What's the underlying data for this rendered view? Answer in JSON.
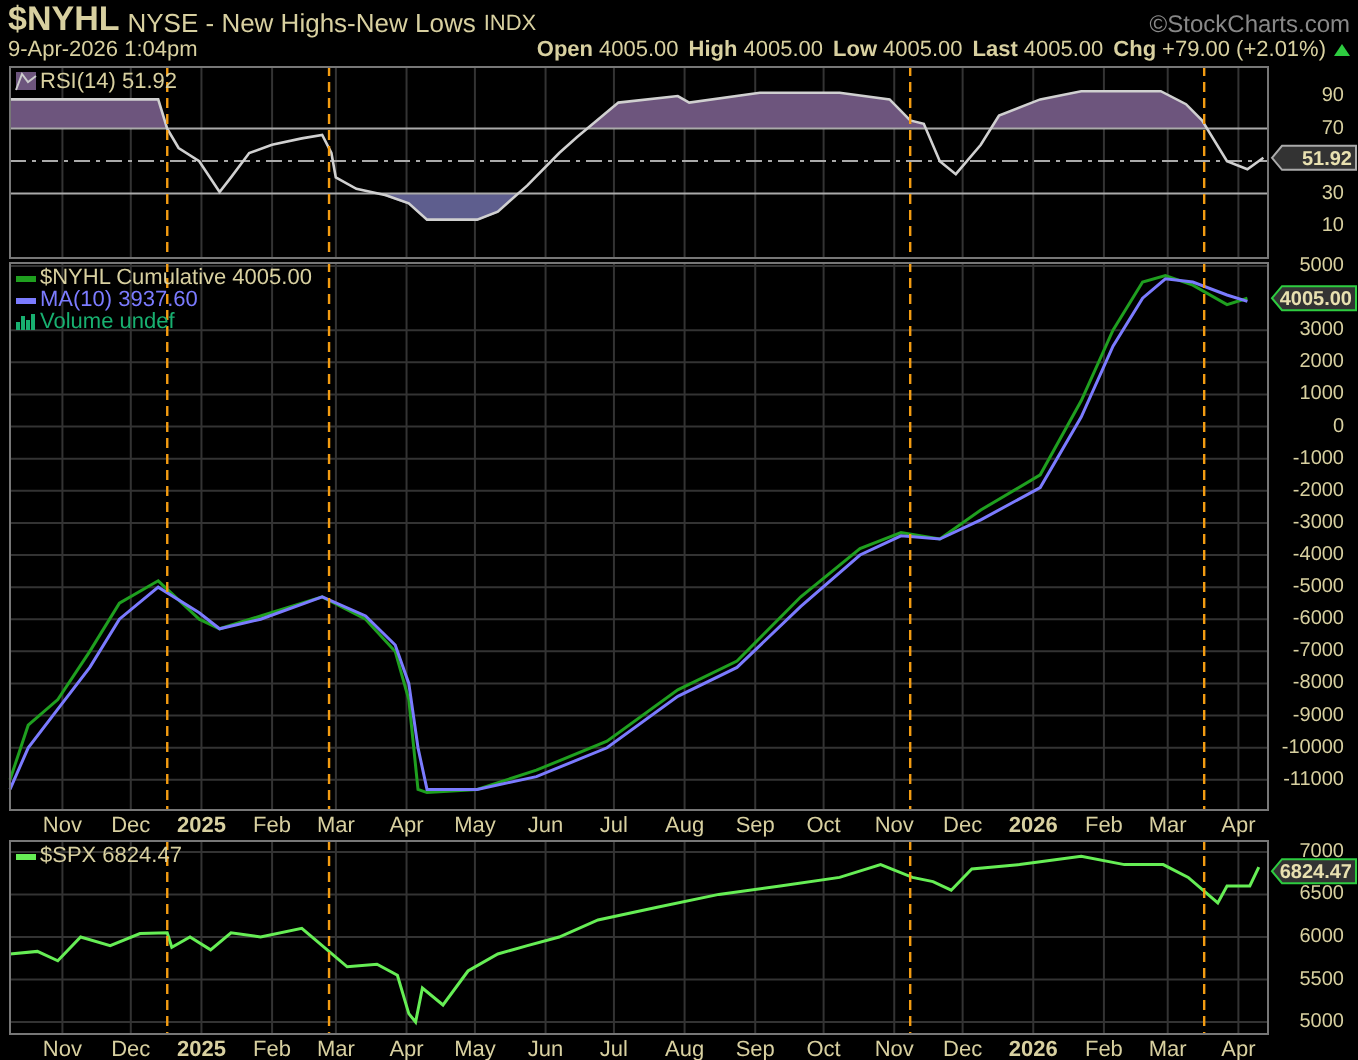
{
  "header": {
    "symbol": "$NYHL",
    "name": "NYSE - New Highs-New Lows",
    "exchange": "INDX",
    "brand": "©StockCharts.com",
    "date": "9-Apr-2026 1:04pm",
    "quotes": [
      {
        "label": "Open",
        "value": "4005.00"
      },
      {
        "label": "High",
        "value": "4005.00"
      },
      {
        "label": "Low",
        "value": "4005.00"
      },
      {
        "label": "Last",
        "value": "4005.00"
      },
      {
        "label": "Chg",
        "value": "+79.00 (+2.01%)"
      }
    ]
  },
  "panels": [
    {
      "kind": "rsi",
      "legend": [
        {
          "kind": "area",
          "value": "51.92",
          "color": "#d8d0a0"
        }
      ],
      "tag": "51.92",
      "chart_data": {
        "type": "line",
        "grid": true,
        "xlim": [
          "2024-10-09",
          "2026-04-14"
        ],
        "ylim": [
          -9.6,
          108.5
        ],
        "x": [
          "2024-10-09",
          "2024-12-13",
          "2024-12-17",
          "2024-12-22",
          "2024-12-31",
          "2025-01-09",
          "2025-01-14",
          "2025-01-22",
          "2025-02-01",
          "2025-02-14",
          "2025-02-23",
          "2025-02-27",
          "2025-03-01",
          "2025-03-10",
          "2025-03-23",
          "2025-04-02",
          "2025-04-10",
          "2025-05-02",
          "2025-05-11",
          "2025-05-24",
          "2025-06-07",
          "2025-06-15",
          "2025-07-03",
          "2025-07-29",
          "2025-08-03",
          "2025-09-03",
          "2025-10-08",
          "2025-10-30",
          "2025-11-08",
          "2025-11-14",
          "2025-11-21",
          "2025-11-28",
          "2025-12-09",
          "2025-12-17",
          "2026-01-04",
          "2026-01-22",
          "2026-02-26",
          "2026-03-09",
          "2026-03-16",
          "2026-03-27",
          "2026-04-05",
          "2026-04-12"
        ],
        "series": [
          {
            "name": "RSI(14)",
            "color": "#d0d0d0",
            "values": [
              88,
              88,
              70,
              58,
              50,
              31,
              40,
              55,
              60,
              64,
              66,
              55,
              40,
              33,
              29,
              24,
              14,
              14,
              19,
              35,
              55,
              65,
              86,
              90,
              86,
              92,
              92,
              88,
              75,
              73,
              50,
              42,
              60,
              78,
              88,
              93,
              93,
              85,
              75,
              50,
              45,
              52
            ]
          }
        ],
        "yticks": [
          10,
          30,
          70,
          90
        ],
        "ref_lines": [
          {
            "axis": "y",
            "value": 70
          },
          {
            "axis": "y",
            "value": 50
          },
          {
            "axis": "y",
            "value": 30
          },
          {
            "axis": "x",
            "value": "2024-12-17"
          },
          {
            "axis": "x",
            "value": "2025-02-26"
          },
          {
            "axis": "x",
            "value": "2025-11-08"
          },
          {
            "axis": "x",
            "value": "2026-03-17"
          }
        ]
      }
    },
    {
      "kind": "price",
      "legend": [
        {
          "kind": "line",
          "value": "4005.00",
          "color": "#d8d0a0"
        },
        {
          "kind": "line",
          "value": "3937.60",
          "color": "#7b7bff"
        },
        {
          "kind": "volume",
          "text": "Volume undef",
          "color": "#18b070"
        }
      ],
      "tag": "4005.00",
      "chart_data": {
        "type": "line",
        "grid": true,
        "xlim": [
          "2024-10-09",
          "2026-04-14"
        ],
        "ylim": [
          -11940,
          5125
        ],
        "x": [
          "2024-10-09",
          "2024-10-17",
          "2024-10-30",
          "2024-11-13",
          "2024-11-26",
          "2024-12-13",
          "2024-12-31",
          "2025-01-09",
          "2025-01-27",
          "2025-02-23",
          "2025-03-14",
          "2025-03-27",
          "2025-04-02",
          "2025-04-06",
          "2025-04-10",
          "2025-05-02",
          "2025-05-28",
          "2025-06-28",
          "2025-07-29",
          "2025-08-24",
          "2025-09-21",
          "2025-10-17",
          "2025-11-04",
          "2025-11-21",
          "2025-12-09",
          "2026-01-04",
          "2026-01-22",
          "2026-02-05",
          "2026-02-18",
          "2026-02-28",
          "2026-03-12",
          "2026-03-27",
          "2026-04-05"
        ],
        "series": [
          {
            "name": "$NYHL Cumulative",
            "color": "#1f9f1f",
            "values": [
              -11000,
              -9300,
              -8500,
              -7000,
              -5500,
              -4800,
              -6000,
              -6300,
              -5900,
              -5300,
              -6000,
              -7000,
              -8500,
              -11300,
              -11400,
              -11300,
              -10700,
              -9800,
              -8200,
              -7300,
              -5300,
              -3800,
              -3300,
              -3500,
              -2600,
              -1500,
              800,
              3000,
              4500,
              4700,
              4400,
              3800,
              4000
            ]
          },
          {
            "name": "MA(10)",
            "color": "#7b7bff",
            "values": [
              -11300,
              -10000,
              -8800,
              -7500,
              -6000,
              -5000,
              -5800,
              -6300,
              -6000,
              -5300,
              -5900,
              -6800,
              -8000,
              -10000,
              -11300,
              -11300,
              -10900,
              -10000,
              -8400,
              -7500,
              -5600,
              -4000,
              -3400,
              -3500,
              -2900,
              -1900,
              300,
              2500,
              4000,
              4600,
              4500,
              4100,
              3900
            ]
          }
        ],
        "yticks": [
          -11000,
          -10000,
          -9000,
          -8000,
          -7000,
          -6000,
          -5000,
          -4000,
          -3000,
          -2000,
          -1000,
          0,
          1000,
          2000,
          3000,
          5000
        ],
        "xticks": [
          {
            "value": "2024-11-01",
            "label": "Nov"
          },
          {
            "value": "2024-12-01",
            "label": "Dec"
          },
          {
            "value": "2025-01-01",
            "label": "2025"
          },
          {
            "value": "2025-02-01",
            "label": "Feb"
          },
          {
            "value": "2025-03-01",
            "label": "Mar"
          },
          {
            "value": "2025-04-01",
            "label": "Apr"
          },
          {
            "value": "2025-05-01",
            "label": "May"
          },
          {
            "value": "2025-06-01",
            "label": "Jun"
          },
          {
            "value": "2025-07-01",
            "label": "Jul"
          },
          {
            "value": "2025-08-01",
            "label": "Aug"
          },
          {
            "value": "2025-09-01",
            "label": "Sep"
          },
          {
            "value": "2025-10-01",
            "label": "Oct"
          },
          {
            "value": "2025-11-01",
            "label": "Nov"
          },
          {
            "value": "2025-12-01",
            "label": "Dec"
          },
          {
            "value": "2026-01-01",
            "label": "2026"
          },
          {
            "value": "2026-02-01",
            "label": "Feb"
          },
          {
            "value": "2026-03-01",
            "label": "Mar"
          },
          {
            "value": "2026-04-01",
            "label": "Apr"
          }
        ],
        "ref_lines": [
          {
            "axis": "x",
            "value": "2024-12-17"
          },
          {
            "axis": "x",
            "value": "2025-02-26"
          },
          {
            "axis": "x",
            "value": "2025-11-08"
          },
          {
            "axis": "x",
            "value": "2026-03-17"
          }
        ]
      }
    },
    {
      "kind": "price",
      "legend": [
        {
          "kind": "line",
          "value": "6824.47",
          "color": "#d8d0a0"
        }
      ],
      "tag": "6824.47",
      "chart_data": {
        "type": "line",
        "grid": true,
        "xlim": [
          "2024-10-09",
          "2026-04-14"
        ],
        "ylim": [
          4860,
          7140
        ],
        "x": [
          "2024-10-09",
          "2024-10-21",
          "2024-10-30",
          "2024-11-09",
          "2024-11-22",
          "2024-12-05",
          "2024-12-17",
          "2024-12-19",
          "2024-12-27",
          "2025-01-05",
          "2025-01-14",
          "2025-01-27",
          "2025-02-14",
          "2025-02-23",
          "2025-03-06",
          "2025-03-19",
          "2025-03-28",
          "2025-04-02",
          "2025-04-05",
          "2025-04-08",
          "2025-04-17",
          "2025-04-28",
          "2025-05-11",
          "2025-05-24",
          "2025-06-07",
          "2025-06-24",
          "2025-07-20",
          "2025-08-16",
          "2025-09-12",
          "2025-10-08",
          "2025-10-26",
          "2025-11-09",
          "2025-11-18",
          "2025-11-26",
          "2025-12-05",
          "2025-12-26",
          "2026-01-22",
          "2026-02-10",
          "2026-02-27",
          "2026-03-10",
          "2026-03-23",
          "2026-03-27",
          "2026-04-06",
          "2026-04-10"
        ],
        "series": [
          {
            "name": "$SPX",
            "color": "#66ee55",
            "values": [
              5800,
              5830,
              5720,
              6000,
              5900,
              6040,
              6050,
              5880,
              6000,
              5850,
              6050,
              6000,
              6100,
              5900,
              5650,
              5680,
              5550,
              5100,
              5000,
              5400,
              5200,
              5600,
              5800,
              5900,
              6000,
              6200,
              6350,
              6500,
              6600,
              6700,
              6850,
              6700,
              6650,
              6550,
              6800,
              6850,
              6950,
              6850,
              6850,
              6700,
              6400,
              6600,
              6600,
              6820
            ]
          }
        ],
        "yticks": [
          5000,
          5500,
          6000,
          6500,
          7000
        ],
        "xticks": [
          {
            "value": "2024-11-01",
            "label": "Nov"
          },
          {
            "value": "2024-12-01",
            "label": "Dec"
          },
          {
            "value": "2025-01-01",
            "label": "2025"
          },
          {
            "value": "2025-02-01",
            "label": "Feb"
          },
          {
            "value": "2025-03-01",
            "label": "Mar"
          },
          {
            "value": "2025-04-01",
            "label": "Apr"
          },
          {
            "value": "2025-05-01",
            "label": "May"
          },
          {
            "value": "2025-06-01",
            "label": "Jun"
          },
          {
            "value": "2025-07-01",
            "label": "Jul"
          },
          {
            "value": "2025-08-01",
            "label": "Aug"
          },
          {
            "value": "2025-09-01",
            "label": "Sep"
          },
          {
            "value": "2025-10-01",
            "label": "Oct"
          },
          {
            "value": "2025-11-01",
            "label": "Nov"
          },
          {
            "value": "2025-12-01",
            "label": "Dec"
          },
          {
            "value": "2026-01-01",
            "label": "2026"
          },
          {
            "value": "2026-02-01",
            "label": "Feb"
          },
          {
            "value": "2026-03-01",
            "label": "Mar"
          },
          {
            "value": "2026-04-01",
            "label": "Apr"
          }
        ],
        "ref_lines": [
          {
            "axis": "x",
            "value": "2024-12-17"
          },
          {
            "axis": "x",
            "value": "2025-02-26"
          },
          {
            "axis": "x",
            "value": "2025-11-08"
          },
          {
            "axis": "x",
            "value": "2026-03-17"
          }
        ]
      }
    }
  ]
}
